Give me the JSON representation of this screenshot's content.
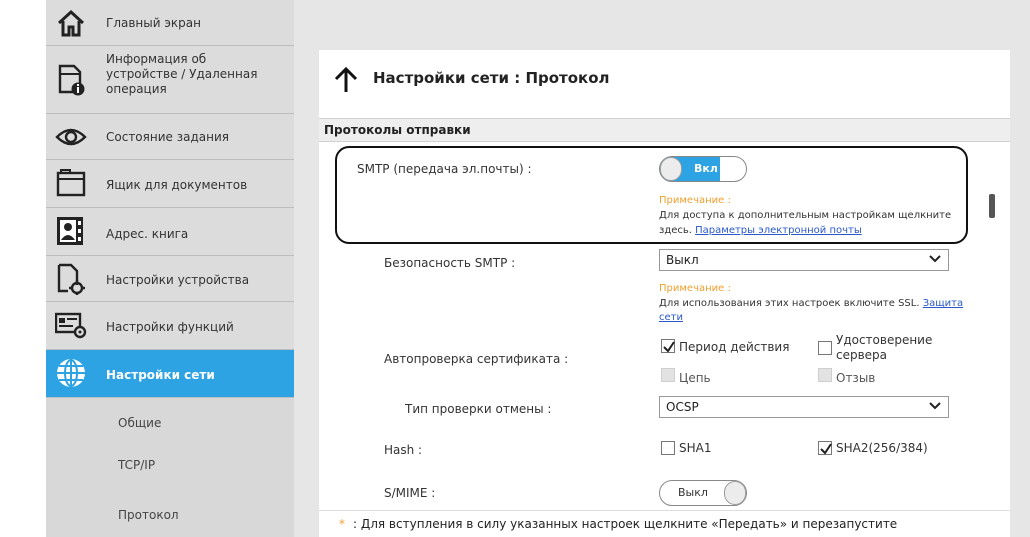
{
  "sidebar": {
    "items": [
      {
        "label": "Главный экран",
        "icon": "home-icon"
      },
      {
        "label": "Информация об устройстве / Удаленная операция",
        "icon": "device-info-icon"
      },
      {
        "label": "Состояние задания",
        "icon": "eye-icon"
      },
      {
        "label": "Ящик для документов",
        "icon": "document-box-icon"
      },
      {
        "label": "Адрес. книга",
        "icon": "address-book-icon"
      },
      {
        "label": "Настройки устройства",
        "icon": "device-settings-icon"
      },
      {
        "label": "Настройки функций",
        "icon": "function-settings-icon"
      },
      {
        "label": "Настройки сети",
        "icon": "globe-icon",
        "active": true
      }
    ],
    "subitems": [
      "Общие",
      "TCP/IP",
      "Протокол"
    ],
    "device_info_lines": [
      "Информация об",
      "устройстве / Удаленная",
      "операция"
    ]
  },
  "header": {
    "title": "Настройки сети : Протокол"
  },
  "section": {
    "title": "Протоколы отправки"
  },
  "smtp": {
    "label": "SMTP (передача эл.почты) :",
    "toggle": "Вкл",
    "note_title": "Примечание :",
    "note_text": "Для доступа к дополнительным настройкам щелкните",
    "note_text2": "здесь.",
    "note_link": "Параметры электронной почты"
  },
  "smtp_security": {
    "label": "Безопасность SMTP :",
    "value": "Выкл",
    "note_title": "Примечание :",
    "note_text": "Для использования этих настроек включите SSL.",
    "note_link1": "Защита",
    "note_link2": "сети"
  },
  "cert_check": {
    "label": "Автопроверка сертификата :",
    "options": [
      {
        "label": "Период действия",
        "checked": true,
        "disabled": false
      },
      {
        "label": "Удостоверение",
        "label2": "сервера",
        "checked": false,
        "disabled": false
      },
      {
        "label": "Цепь",
        "checked": false,
        "disabled": true
      },
      {
        "label": "Отзыв",
        "checked": false,
        "disabled": true
      }
    ]
  },
  "revocation": {
    "label": "Тип проверки отмены :",
    "value": "OCSP"
  },
  "hash": {
    "label": "Hash :",
    "options": [
      {
        "label": "SHA1",
        "checked": false
      },
      {
        "label": "SHA2(256/384)",
        "checked": true
      }
    ]
  },
  "smime": {
    "label": "S/MIME :",
    "toggle": "Выкл"
  },
  "footer": {
    "asterisk": "*",
    "text": ": Для вступления в силу указанных настроек щелкните «Передать» и перезапустите"
  },
  "colors": {
    "accent": "#2ea3e3",
    "note": "#f0a030",
    "link": "#2a58c8"
  }
}
